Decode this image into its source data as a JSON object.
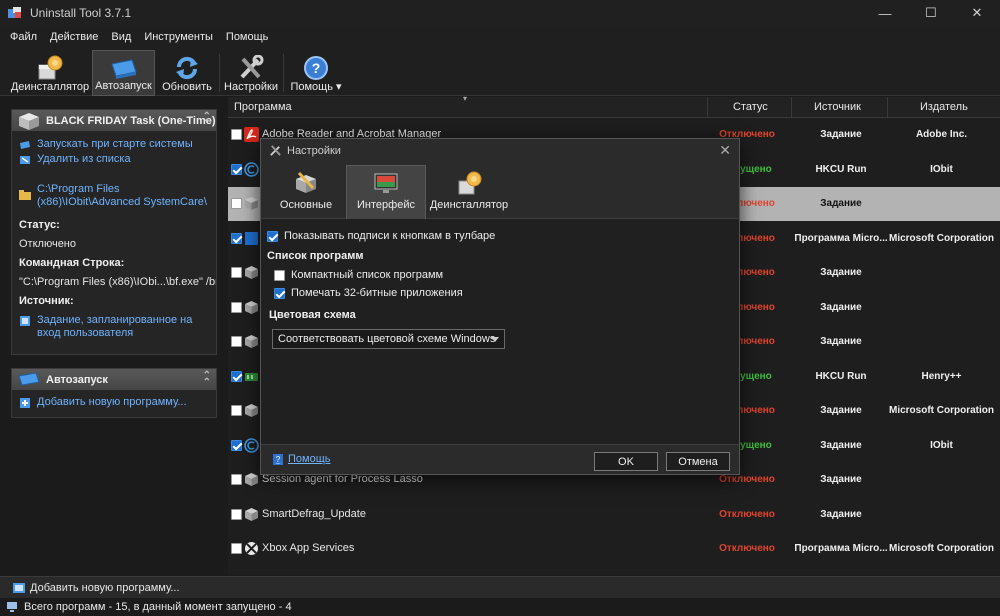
{
  "window": {
    "title": "Uninstall Tool 3.7.1",
    "minimize": "—",
    "maximize": "☐",
    "close": "✕"
  },
  "menu": [
    "Файл",
    "Действие",
    "Вид",
    "Инструменты",
    "Помощь"
  ],
  "toolbar": {
    "uninstaller": "Деинсталлятор",
    "autorun": "Автозапуск",
    "refresh": "Обновить",
    "settings": "Настройки",
    "help": "Помощь"
  },
  "sidebar": {
    "panel1": {
      "title": "BLACK FRIDAY Task (One-Time)",
      "link_start": "Запускать при старте системы",
      "link_remove": "Удалить из списка",
      "path": "C:\\Program Files (x86)\\IObit\\Advanced SystemCare\\",
      "status_label": "Статус:",
      "status_value": "Отключено",
      "cmd_label": "Командная Строка:",
      "cmd_value": "\"C:\\Program Files (x86)\\IObi...\\bf.exe\" /br",
      "source_label": "Источник:",
      "source_value": "Задание, запланированное на вход пользователя"
    },
    "panel2": {
      "title": "Автозапуск",
      "link_add": "Добавить новую программу..."
    }
  },
  "columns": {
    "program": "Программа",
    "status": "Статус",
    "source": "Источник",
    "publisher": "Издатель"
  },
  "rows": [
    {
      "name": "Adobe Reader and Acrobat Manager",
      "status": "Отключено",
      "source": "Задание",
      "publisher": "Adobe Inc.",
      "checked": false
    },
    {
      "name": "",
      "status": "Запущено",
      "source": "HKCU Run",
      "publisher": "IObit",
      "checked": true
    },
    {
      "name": "",
      "status": "Отключено",
      "source": "Задание",
      "publisher": "",
      "checked": false
    },
    {
      "name": "",
      "status": "Отключено",
      "source": "Программа Micro...",
      "publisher": "Microsoft Corporation",
      "checked": true
    },
    {
      "name": "",
      "status": "Отключено",
      "source": "Задание",
      "publisher": "",
      "checked": false
    },
    {
      "name": "",
      "status": "Отключено",
      "source": "Задание",
      "publisher": "",
      "checked": false
    },
    {
      "name": "",
      "status": "Отключено",
      "source": "Задание",
      "publisher": "",
      "checked": false
    },
    {
      "name": "",
      "status": "Запущено",
      "source": "HKCU Run",
      "publisher": "Henry++",
      "checked": true
    },
    {
      "name": "",
      "status": "Отключено",
      "source": "Задание",
      "publisher": "Microsoft Corporation",
      "checked": false
    },
    {
      "name": "",
      "status": "Запущено",
      "source": "Задание",
      "publisher": "IObit",
      "checked": true
    },
    {
      "name": "Session agent for Process Lasso",
      "status": "Отключено",
      "source": "Задание",
      "publisher": "",
      "checked": false
    },
    {
      "name": "SmartDefrag_Update",
      "status": "Отключено",
      "source": "Задание",
      "publisher": "",
      "checked": false
    },
    {
      "name": "Xbox App Services",
      "status": "Отключено",
      "source": "Программа Micro...",
      "publisher": "Microsoft Corporation",
      "checked": false
    }
  ],
  "bottom": {
    "add": "Добавить новую программу..."
  },
  "statusbar": {
    "text": "Всего программ - 15, в данный момент запущено - 4"
  },
  "dialog": {
    "title": "Настройки",
    "tabs": {
      "basic": "Основные",
      "interface": "Интерфейс",
      "uninstaller": "Деинсталлятор"
    },
    "show_captions": "Показывать подписи к кнопкам в тулбаре",
    "list_section": "Список программ",
    "compact_list": "Компактный список программ",
    "mark_32bit": "Помечать 32-битные приложения",
    "color_section": "Цветовая схема",
    "color_value": "Соответствовать цветовой схеме Windows",
    "help": "Помощь",
    "ok": "OK",
    "cancel": "Отмена"
  },
  "colors": {
    "accent": "#1e6fcf",
    "link": "#6fb4ff",
    "disabled": "#e0442f",
    "running": "#3fbf3f"
  }
}
